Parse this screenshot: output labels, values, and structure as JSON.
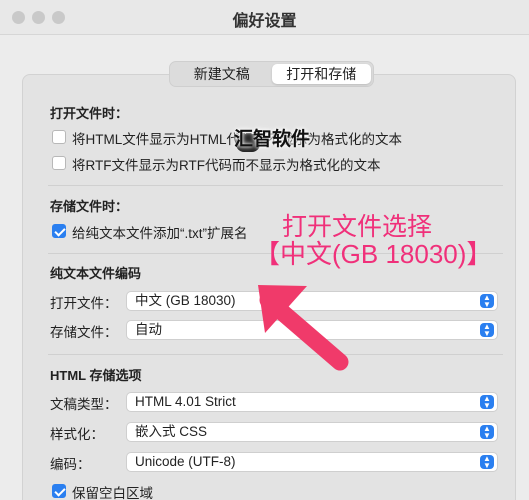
{
  "window": {
    "title": "偏好设置"
  },
  "tabs": [
    "新建文稿",
    "打开和存储"
  ],
  "open_section": {
    "heading": "打开文件时：",
    "opt1": "将HTML文件显示为HTML代码而不显示为格式化的文本",
    "opt2": "将RTF文件显示为RTF代码而不显示为格式化的文本"
  },
  "save_section": {
    "heading": "存储文件时：",
    "opt1": "给纯文本文件添加“.txt”扩展名"
  },
  "encoding_section": {
    "heading": "纯文本文件编码",
    "open_label": "打开文件：",
    "open_value": "中文 (GB 18030)",
    "save_label": "存储文件：",
    "save_value": "自动"
  },
  "html_section": {
    "heading": "HTML 存储选项",
    "doctype_label": "文稿类型：",
    "doctype_value": "HTML 4.01 Strict",
    "style_label": "样式化：",
    "style_value": "嵌入式 CSS",
    "encoding_label": "编码：",
    "encoding_value": "Unicode (UTF-8)",
    "preserve_whitespace": "保留空白区域"
  },
  "overlay": {
    "watermark": "汇智软件",
    "annotation_line1": "打开文件选择",
    "annotation_line2": "【中文(GB 18030)】"
  },
  "colors": {
    "accent": "#2a7ff0",
    "annotation": "#f0307a"
  }
}
